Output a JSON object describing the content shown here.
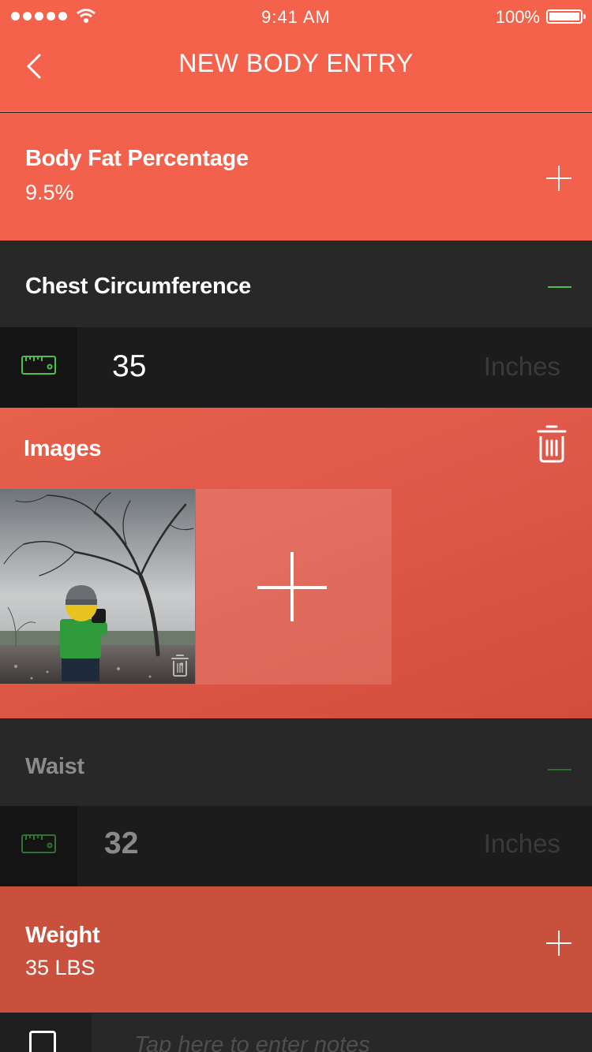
{
  "status_bar": {
    "time": "9:41 AM",
    "battery": "100%",
    "icons": [
      "signal-dots-icon",
      "wifi-icon",
      "battery-icon"
    ]
  },
  "nav": {
    "title": "NEW BODY ENTRY",
    "back_icon": "chevron-left-icon"
  },
  "body_fat": {
    "label": "Body Fat Percentage",
    "value": "9.5%",
    "action_icon": "plus-icon"
  },
  "chest": {
    "label": "Chest Circumference",
    "value": "35",
    "unit": "Inches",
    "action_icon": "minus-icon",
    "field_icon": "ruler-icon"
  },
  "images": {
    "label": "Images",
    "action_icon": "trash-icon",
    "add_icon": "plus-icon"
  },
  "waist": {
    "label": "Waist",
    "value": "32",
    "unit": "Inches",
    "action_icon": "minus-icon",
    "field_icon": "ruler-icon"
  },
  "weight": {
    "label": "Weight",
    "value": "35 LBS",
    "action_icon": "plus-icon"
  },
  "notes": {
    "placeholder": "Tap here to enter notes",
    "icon": "document-icon"
  },
  "colors": {
    "accent": "#f4624c",
    "dark_row": "#282828",
    "input_row": "#1c1c1c",
    "minus_green": "#4cbf4c",
    "weight_row": "#c8503d"
  }
}
